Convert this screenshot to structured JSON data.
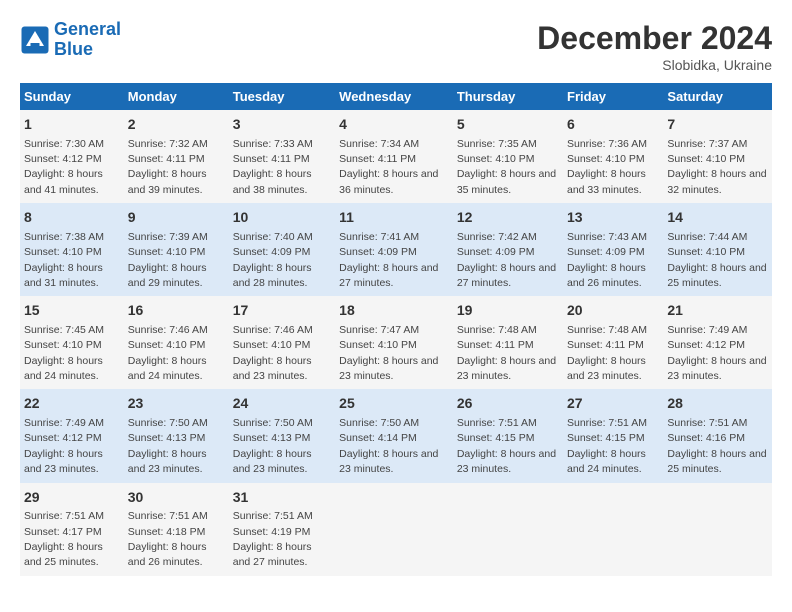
{
  "header": {
    "logo_line1": "General",
    "logo_line2": "Blue",
    "main_title": "December 2024",
    "subtitle": "Slobidka, Ukraine"
  },
  "days_of_week": [
    "Sunday",
    "Monday",
    "Tuesday",
    "Wednesday",
    "Thursday",
    "Friday",
    "Saturday"
  ],
  "weeks": [
    [
      {
        "num": "1",
        "sunrise": "Sunrise: 7:30 AM",
        "sunset": "Sunset: 4:12 PM",
        "daylight": "Daylight: 8 hours and 41 minutes."
      },
      {
        "num": "2",
        "sunrise": "Sunrise: 7:32 AM",
        "sunset": "Sunset: 4:11 PM",
        "daylight": "Daylight: 8 hours and 39 minutes."
      },
      {
        "num": "3",
        "sunrise": "Sunrise: 7:33 AM",
        "sunset": "Sunset: 4:11 PM",
        "daylight": "Daylight: 8 hours and 38 minutes."
      },
      {
        "num": "4",
        "sunrise": "Sunrise: 7:34 AM",
        "sunset": "Sunset: 4:11 PM",
        "daylight": "Daylight: 8 hours and 36 minutes."
      },
      {
        "num": "5",
        "sunrise": "Sunrise: 7:35 AM",
        "sunset": "Sunset: 4:10 PM",
        "daylight": "Daylight: 8 hours and 35 minutes."
      },
      {
        "num": "6",
        "sunrise": "Sunrise: 7:36 AM",
        "sunset": "Sunset: 4:10 PM",
        "daylight": "Daylight: 8 hours and 33 minutes."
      },
      {
        "num": "7",
        "sunrise": "Sunrise: 7:37 AM",
        "sunset": "Sunset: 4:10 PM",
        "daylight": "Daylight: 8 hours and 32 minutes."
      }
    ],
    [
      {
        "num": "8",
        "sunrise": "Sunrise: 7:38 AM",
        "sunset": "Sunset: 4:10 PM",
        "daylight": "Daylight: 8 hours and 31 minutes."
      },
      {
        "num": "9",
        "sunrise": "Sunrise: 7:39 AM",
        "sunset": "Sunset: 4:10 PM",
        "daylight": "Daylight: 8 hours and 29 minutes."
      },
      {
        "num": "10",
        "sunrise": "Sunrise: 7:40 AM",
        "sunset": "Sunset: 4:09 PM",
        "daylight": "Daylight: 8 hours and 28 minutes."
      },
      {
        "num": "11",
        "sunrise": "Sunrise: 7:41 AM",
        "sunset": "Sunset: 4:09 PM",
        "daylight": "Daylight: 8 hours and 27 minutes."
      },
      {
        "num": "12",
        "sunrise": "Sunrise: 7:42 AM",
        "sunset": "Sunset: 4:09 PM",
        "daylight": "Daylight: 8 hours and 27 minutes."
      },
      {
        "num": "13",
        "sunrise": "Sunrise: 7:43 AM",
        "sunset": "Sunset: 4:09 PM",
        "daylight": "Daylight: 8 hours and 26 minutes."
      },
      {
        "num": "14",
        "sunrise": "Sunrise: 7:44 AM",
        "sunset": "Sunset: 4:10 PM",
        "daylight": "Daylight: 8 hours and 25 minutes."
      }
    ],
    [
      {
        "num": "15",
        "sunrise": "Sunrise: 7:45 AM",
        "sunset": "Sunset: 4:10 PM",
        "daylight": "Daylight: 8 hours and 24 minutes."
      },
      {
        "num": "16",
        "sunrise": "Sunrise: 7:46 AM",
        "sunset": "Sunset: 4:10 PM",
        "daylight": "Daylight: 8 hours and 24 minutes."
      },
      {
        "num": "17",
        "sunrise": "Sunrise: 7:46 AM",
        "sunset": "Sunset: 4:10 PM",
        "daylight": "Daylight: 8 hours and 23 minutes."
      },
      {
        "num": "18",
        "sunrise": "Sunrise: 7:47 AM",
        "sunset": "Sunset: 4:10 PM",
        "daylight": "Daylight: 8 hours and 23 minutes."
      },
      {
        "num": "19",
        "sunrise": "Sunrise: 7:48 AM",
        "sunset": "Sunset: 4:11 PM",
        "daylight": "Daylight: 8 hours and 23 minutes."
      },
      {
        "num": "20",
        "sunrise": "Sunrise: 7:48 AM",
        "sunset": "Sunset: 4:11 PM",
        "daylight": "Daylight: 8 hours and 23 minutes."
      },
      {
        "num": "21",
        "sunrise": "Sunrise: 7:49 AM",
        "sunset": "Sunset: 4:12 PM",
        "daylight": "Daylight: 8 hours and 23 minutes."
      }
    ],
    [
      {
        "num": "22",
        "sunrise": "Sunrise: 7:49 AM",
        "sunset": "Sunset: 4:12 PM",
        "daylight": "Daylight: 8 hours and 23 minutes."
      },
      {
        "num": "23",
        "sunrise": "Sunrise: 7:50 AM",
        "sunset": "Sunset: 4:13 PM",
        "daylight": "Daylight: 8 hours and 23 minutes."
      },
      {
        "num": "24",
        "sunrise": "Sunrise: 7:50 AM",
        "sunset": "Sunset: 4:13 PM",
        "daylight": "Daylight: 8 hours and 23 minutes."
      },
      {
        "num": "25",
        "sunrise": "Sunrise: 7:50 AM",
        "sunset": "Sunset: 4:14 PM",
        "daylight": "Daylight: 8 hours and 23 minutes."
      },
      {
        "num": "26",
        "sunrise": "Sunrise: 7:51 AM",
        "sunset": "Sunset: 4:15 PM",
        "daylight": "Daylight: 8 hours and 23 minutes."
      },
      {
        "num": "27",
        "sunrise": "Sunrise: 7:51 AM",
        "sunset": "Sunset: 4:15 PM",
        "daylight": "Daylight: 8 hours and 24 minutes."
      },
      {
        "num": "28",
        "sunrise": "Sunrise: 7:51 AM",
        "sunset": "Sunset: 4:16 PM",
        "daylight": "Daylight: 8 hours and 25 minutes."
      }
    ],
    [
      {
        "num": "29",
        "sunrise": "Sunrise: 7:51 AM",
        "sunset": "Sunset: 4:17 PM",
        "daylight": "Daylight: 8 hours and 25 minutes."
      },
      {
        "num": "30",
        "sunrise": "Sunrise: 7:51 AM",
        "sunset": "Sunset: 4:18 PM",
        "daylight": "Daylight: 8 hours and 26 minutes."
      },
      {
        "num": "31",
        "sunrise": "Sunrise: 7:51 AM",
        "sunset": "Sunset: 4:19 PM",
        "daylight": "Daylight: 8 hours and 27 minutes."
      },
      {
        "num": "",
        "sunrise": "",
        "sunset": "",
        "daylight": ""
      },
      {
        "num": "",
        "sunrise": "",
        "sunset": "",
        "daylight": ""
      },
      {
        "num": "",
        "sunrise": "",
        "sunset": "",
        "daylight": ""
      },
      {
        "num": "",
        "sunrise": "",
        "sunset": "",
        "daylight": ""
      }
    ]
  ]
}
